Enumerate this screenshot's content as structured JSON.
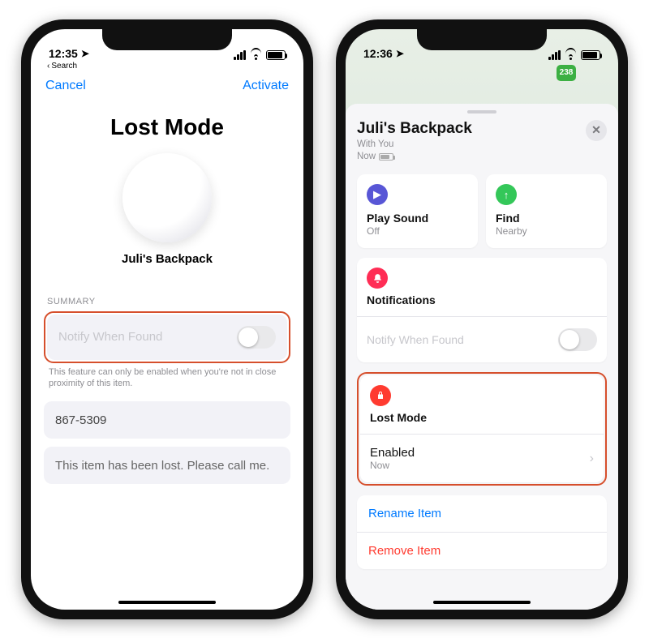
{
  "left": {
    "status": {
      "time": "12:35",
      "back_label": "Search"
    },
    "nav": {
      "cancel": "Cancel",
      "activate": "Activate"
    },
    "title": "Lost Mode",
    "item_name": "Juli's Backpack",
    "summary_label": "SUMMARY",
    "notify_label": "Notify When Found",
    "notify_footnote": "This feature can only be enabled when you're not in close proximity of this item.",
    "phone_value": "867-5309",
    "message_value": "This item has been lost. Please call me."
  },
  "right": {
    "status": {
      "time": "12:36"
    },
    "map": {
      "route_badge": "238"
    },
    "sheet": {
      "title": "Juli's Backpack",
      "sub_location": "With You",
      "sub_time": "Now",
      "tiles": {
        "play": {
          "title": "Play Sound",
          "sub": "Off"
        },
        "find": {
          "title": "Find",
          "sub": "Nearby"
        }
      },
      "notifications": {
        "title": "Notifications",
        "row_label": "Notify When Found"
      },
      "lost_mode": {
        "title": "Lost Mode",
        "status_label": "Enabled",
        "status_sub": "Now"
      },
      "links": {
        "rename": "Rename Item",
        "remove": "Remove Item"
      }
    }
  }
}
